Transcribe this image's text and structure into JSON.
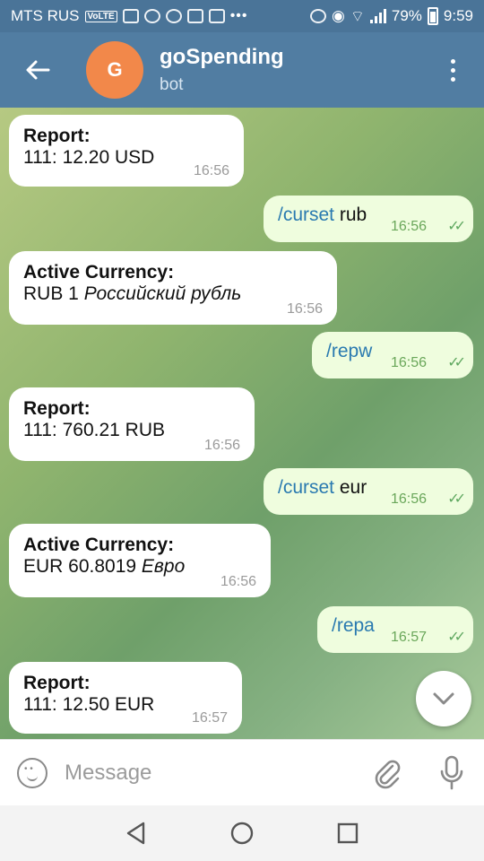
{
  "status": {
    "carrier": "MTS RUS",
    "volte": "VoLTE",
    "battery": "79%",
    "time": "9:59"
  },
  "header": {
    "avatar_letter": "G",
    "title": "goSpending",
    "subtitle": "bot"
  },
  "messages": [
    {
      "dir": "in",
      "line1": "Report:",
      "line2": "111: 12.20 USD",
      "time": "16:56"
    },
    {
      "dir": "out",
      "cmd": "/curset",
      "arg": " rub",
      "time": "16:56"
    },
    {
      "dir": "in",
      "line1": "Active Currency:",
      "line2_plain": "RUB 1 ",
      "line2_italic": "Российский рубль",
      "time": "16:56"
    },
    {
      "dir": "out",
      "cmd": "/repw",
      "arg": "",
      "time": "16:56"
    },
    {
      "dir": "in",
      "line1": "Report:",
      "line2": "111: 760.21 RUB",
      "time": "16:56"
    },
    {
      "dir": "out",
      "cmd": "/curset",
      "arg": " eur",
      "time": "16:56"
    },
    {
      "dir": "in",
      "line1": "Active Currency:",
      "line2_plain": "EUR 60.8019 ",
      "line2_italic": "Евро",
      "time": "16:56"
    },
    {
      "dir": "out",
      "cmd": "/repa",
      "arg": "",
      "time": "16:57"
    },
    {
      "dir": "in",
      "line1": "Report:",
      "line2": "111: 12.50 EUR",
      "time": "16:57"
    }
  ],
  "input": {
    "placeholder": "Message"
  },
  "colors": {
    "header": "#517da2",
    "outgoing_bubble": "#effdde",
    "incoming_bubble": "#ffffff",
    "avatar": "#f2884a"
  }
}
